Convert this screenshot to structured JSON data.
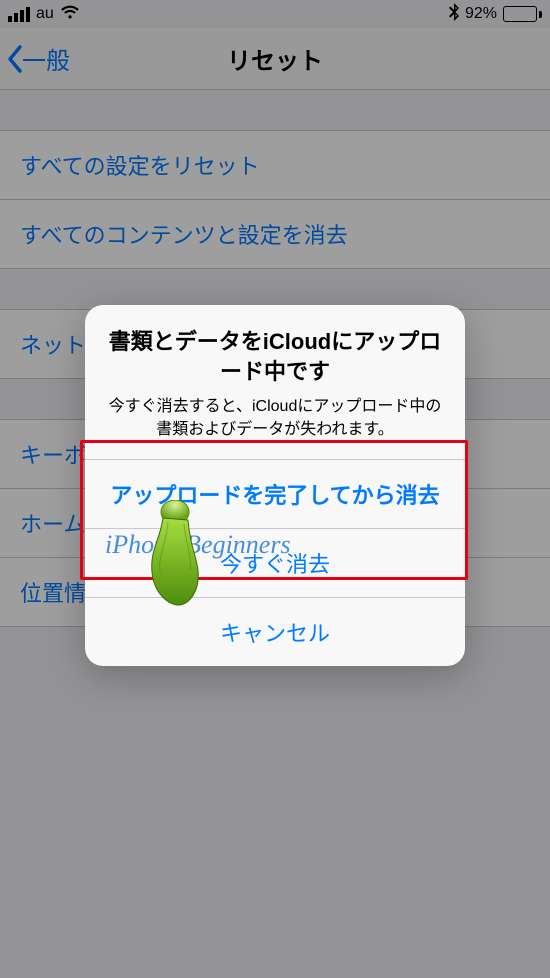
{
  "status": {
    "carrier": "au",
    "battery_pct": "92%"
  },
  "nav": {
    "back_label": "一般",
    "title": "リセット"
  },
  "cells": {
    "reset_all_settings": "すべての設定をリセット",
    "erase_all": "すべてのコンテンツと設定を消去",
    "network": "ネットワーク設定をリセット",
    "keyboard": "キーボードの変換学習をリセット",
    "home": "ホーム画面のレイアウトをリセット",
    "location": "位置情報とプライバシーをリセット"
  },
  "alert": {
    "title": "書類とデータをiCloudにアップロード中です",
    "message": "今すぐ消去すると、iCloudにアップロード中の書類およびデータが失われます。",
    "btn_finish": "アップロードを完了してから消去",
    "btn_now": "今すぐ消去",
    "btn_cancel": "キャンセル"
  },
  "watermark": "iPhone Beginners"
}
